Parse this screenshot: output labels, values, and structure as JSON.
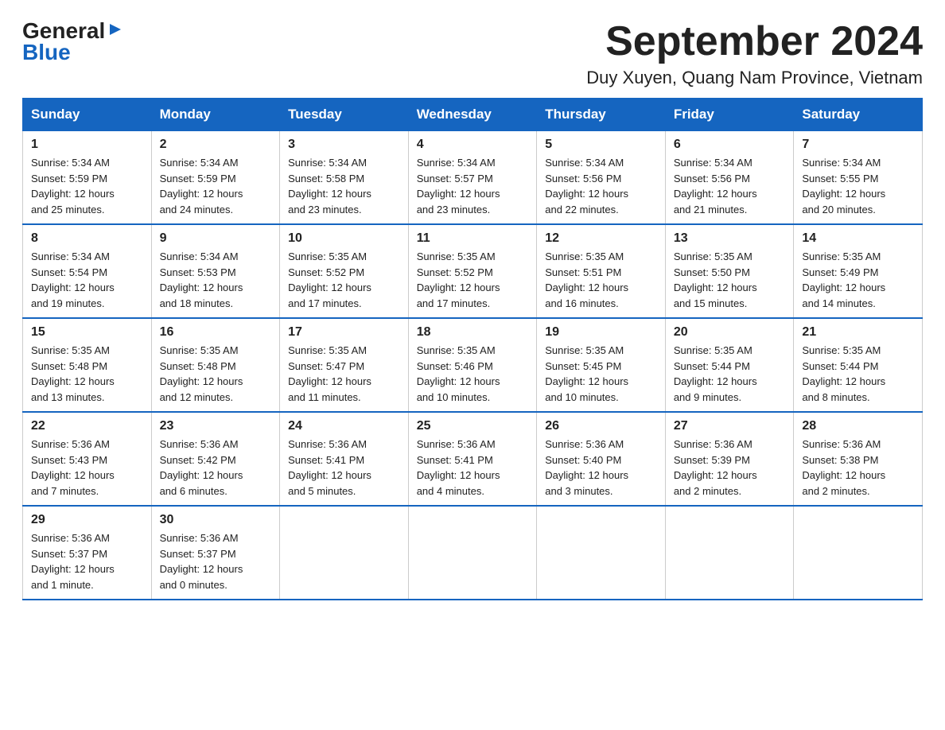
{
  "header": {
    "title": "September 2024",
    "subtitle": "Duy Xuyen, Quang Nam Province, Vietnam",
    "logo_general": "General",
    "logo_blue": "Blue"
  },
  "days_of_week": [
    "Sunday",
    "Monday",
    "Tuesday",
    "Wednesday",
    "Thursday",
    "Friday",
    "Saturday"
  ],
  "weeks": [
    [
      {
        "day": "1",
        "sunrise": "5:34 AM",
        "sunset": "5:59 PM",
        "daylight": "12 hours and 25 minutes."
      },
      {
        "day": "2",
        "sunrise": "5:34 AM",
        "sunset": "5:59 PM",
        "daylight": "12 hours and 24 minutes."
      },
      {
        "day": "3",
        "sunrise": "5:34 AM",
        "sunset": "5:58 PM",
        "daylight": "12 hours and 23 minutes."
      },
      {
        "day": "4",
        "sunrise": "5:34 AM",
        "sunset": "5:57 PM",
        "daylight": "12 hours and 23 minutes."
      },
      {
        "day": "5",
        "sunrise": "5:34 AM",
        "sunset": "5:56 PM",
        "daylight": "12 hours and 22 minutes."
      },
      {
        "day": "6",
        "sunrise": "5:34 AM",
        "sunset": "5:56 PM",
        "daylight": "12 hours and 21 minutes."
      },
      {
        "day": "7",
        "sunrise": "5:34 AM",
        "sunset": "5:55 PM",
        "daylight": "12 hours and 20 minutes."
      }
    ],
    [
      {
        "day": "8",
        "sunrise": "5:34 AM",
        "sunset": "5:54 PM",
        "daylight": "12 hours and 19 minutes."
      },
      {
        "day": "9",
        "sunrise": "5:34 AM",
        "sunset": "5:53 PM",
        "daylight": "12 hours and 18 minutes."
      },
      {
        "day": "10",
        "sunrise": "5:35 AM",
        "sunset": "5:52 PM",
        "daylight": "12 hours and 17 minutes."
      },
      {
        "day": "11",
        "sunrise": "5:35 AM",
        "sunset": "5:52 PM",
        "daylight": "12 hours and 17 minutes."
      },
      {
        "day": "12",
        "sunrise": "5:35 AM",
        "sunset": "5:51 PM",
        "daylight": "12 hours and 16 minutes."
      },
      {
        "day": "13",
        "sunrise": "5:35 AM",
        "sunset": "5:50 PM",
        "daylight": "12 hours and 15 minutes."
      },
      {
        "day": "14",
        "sunrise": "5:35 AM",
        "sunset": "5:49 PM",
        "daylight": "12 hours and 14 minutes."
      }
    ],
    [
      {
        "day": "15",
        "sunrise": "5:35 AM",
        "sunset": "5:48 PM",
        "daylight": "12 hours and 13 minutes."
      },
      {
        "day": "16",
        "sunrise": "5:35 AM",
        "sunset": "5:48 PM",
        "daylight": "12 hours and 12 minutes."
      },
      {
        "day": "17",
        "sunrise": "5:35 AM",
        "sunset": "5:47 PM",
        "daylight": "12 hours and 11 minutes."
      },
      {
        "day": "18",
        "sunrise": "5:35 AM",
        "sunset": "5:46 PM",
        "daylight": "12 hours and 10 minutes."
      },
      {
        "day": "19",
        "sunrise": "5:35 AM",
        "sunset": "5:45 PM",
        "daylight": "12 hours and 10 minutes."
      },
      {
        "day": "20",
        "sunrise": "5:35 AM",
        "sunset": "5:44 PM",
        "daylight": "12 hours and 9 minutes."
      },
      {
        "day": "21",
        "sunrise": "5:35 AM",
        "sunset": "5:44 PM",
        "daylight": "12 hours and 8 minutes."
      }
    ],
    [
      {
        "day": "22",
        "sunrise": "5:36 AM",
        "sunset": "5:43 PM",
        "daylight": "12 hours and 7 minutes."
      },
      {
        "day": "23",
        "sunrise": "5:36 AM",
        "sunset": "5:42 PM",
        "daylight": "12 hours and 6 minutes."
      },
      {
        "day": "24",
        "sunrise": "5:36 AM",
        "sunset": "5:41 PM",
        "daylight": "12 hours and 5 minutes."
      },
      {
        "day": "25",
        "sunrise": "5:36 AM",
        "sunset": "5:41 PM",
        "daylight": "12 hours and 4 minutes."
      },
      {
        "day": "26",
        "sunrise": "5:36 AM",
        "sunset": "5:40 PM",
        "daylight": "12 hours and 3 minutes."
      },
      {
        "day": "27",
        "sunrise": "5:36 AM",
        "sunset": "5:39 PM",
        "daylight": "12 hours and 2 minutes."
      },
      {
        "day": "28",
        "sunrise": "5:36 AM",
        "sunset": "5:38 PM",
        "daylight": "12 hours and 2 minutes."
      }
    ],
    [
      {
        "day": "29",
        "sunrise": "5:36 AM",
        "sunset": "5:37 PM",
        "daylight": "12 hours and 1 minute."
      },
      {
        "day": "30",
        "sunrise": "5:36 AM",
        "sunset": "5:37 PM",
        "daylight": "12 hours and 0 minutes."
      },
      null,
      null,
      null,
      null,
      null
    ]
  ],
  "labels": {
    "sunrise": "Sunrise:",
    "sunset": "Sunset:",
    "daylight": "Daylight:"
  }
}
